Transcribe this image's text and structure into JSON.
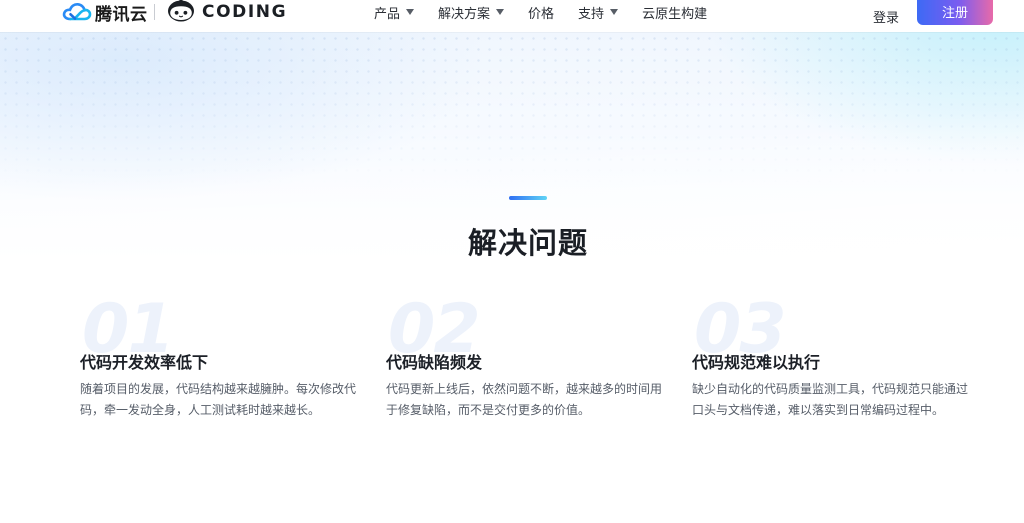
{
  "header": {
    "brand_tencent": "腾讯云",
    "brand_coding": "CODING",
    "nav": [
      {
        "label": "产品",
        "has_dropdown": true
      },
      {
        "label": "解决方案",
        "has_dropdown": true
      },
      {
        "label": "价格",
        "has_dropdown": false
      },
      {
        "label": "支持",
        "has_dropdown": true
      },
      {
        "label": "云原生构建",
        "has_dropdown": false
      }
    ],
    "login_label": "登录",
    "register_label": "注册"
  },
  "section": {
    "title": "解决问题",
    "cards": [
      {
        "number": "01",
        "title": "代码开发效率低下",
        "desc": "随着项目的发展，代码结构越来越臃肿。每次修改代码，牵一发动全身，人工测试耗时越来越长。"
      },
      {
        "number": "02",
        "title": "代码缺陷频发",
        "desc": "代码更新上线后，依然问题不断，越来越多的时间用于修复缺陷，而不是交付更多的价值。"
      },
      {
        "number": "03",
        "title": "代码规范难以执行",
        "desc": "缺少自动化的代码质量监测工具，代码规范只能通过口头与文档传递，难以落实到日常编码过程中。"
      }
    ]
  },
  "colors": {
    "accent_blue": "#2f6ff3",
    "accent_cyan": "#60d4f5",
    "register_gradient": [
      "#3d6af5",
      "#7a5cf0",
      "#e86aa9"
    ],
    "title_text": "#1a1e25",
    "body_text": "#565d68"
  },
  "icons": {
    "tencent_logo": "tencent-cloud-icon",
    "coding_logo": "coding-mascot-icon",
    "dropdown": "caret-down-icon"
  }
}
